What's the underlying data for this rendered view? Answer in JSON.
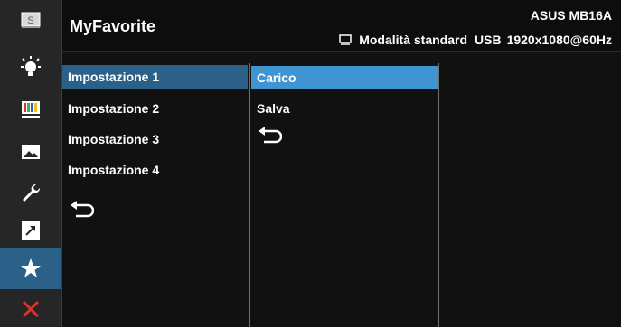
{
  "header": {
    "title": "MyFavorite",
    "model": "ASUS MB16A",
    "mode": "Modalità standard",
    "input": "USB",
    "resolution": "1920x1080@60Hz"
  },
  "sidebar": {
    "items": [
      {
        "icon": "splendid-s-icon"
      },
      {
        "icon": "brightness-icon"
      },
      {
        "icon": "color-bars-icon"
      },
      {
        "icon": "image-icon"
      },
      {
        "icon": "wrench-icon"
      },
      {
        "icon": "shortcut-icon"
      },
      {
        "icon": "star-icon",
        "active": true
      },
      {
        "icon": "close-icon"
      }
    ]
  },
  "menu": {
    "level1": [
      "Impostazione 1",
      "Impostazione 2",
      "Impostazione 3",
      "Impostazione 4"
    ],
    "level2": [
      "Carico",
      "Salva"
    ]
  },
  "colors": {
    "accent_dark": "#2b6189",
    "accent_light": "#3f94d2",
    "close_red": "#e0322c"
  }
}
